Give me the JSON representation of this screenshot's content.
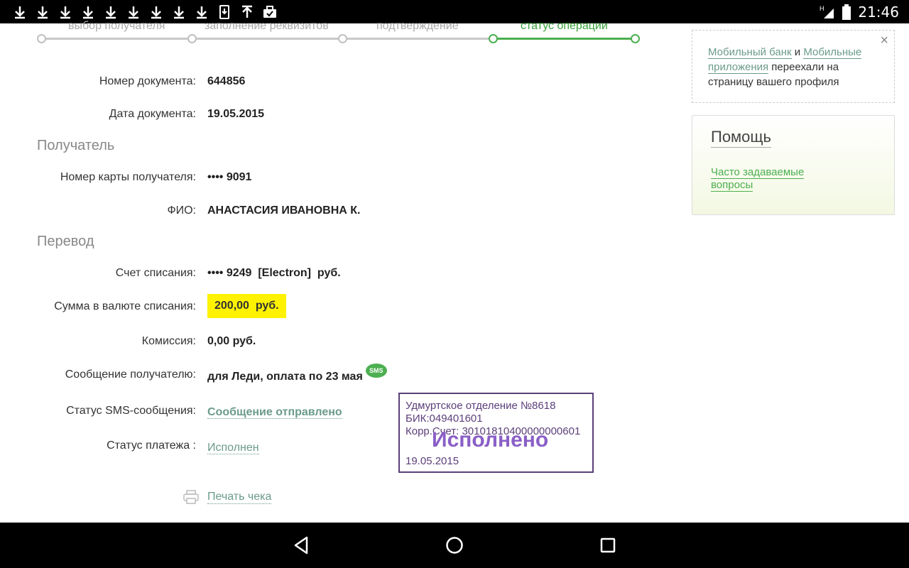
{
  "status_bar": {
    "time": "21:46",
    "network": "H"
  },
  "stepper": {
    "steps": [
      {
        "label": "выбор получателя"
      },
      {
        "label": "заполнение реквизитов"
      },
      {
        "label": "подтверждение"
      },
      {
        "label": "статус операции"
      }
    ]
  },
  "document": {
    "number_label": "Номер документа:",
    "number_value": "644856",
    "date_label": "Дата документа:",
    "date_value": "19.05.2015"
  },
  "recipient": {
    "section_title": "Получатель",
    "card_label": "Номер карты получателя:",
    "card_value": "•••• 9091",
    "name_label": "ФИО:",
    "name_value": "АНАСТАСИЯ ИВАНОВНА К."
  },
  "transfer": {
    "section_title": "Перевод",
    "account_label": "Счет списания:",
    "account_value": "•••• 9249  [Electron]  руб.",
    "amount_label": "Сумма в валюте списания:",
    "amount_value": "200,00  руб.",
    "fee_label": "Комиссия:",
    "fee_value": "0,00 руб.",
    "message_label": "Сообщение получателю:",
    "message_value": "для Леди, оплата по 23 мая",
    "sms_badge": "SMS",
    "sms_status_label": "Статус SMS-сообщения:",
    "sms_status_value": "Сообщение отправлено",
    "payment_status_label": "Статус платежа :",
    "payment_status_value": "Исполнен"
  },
  "stamp": {
    "line1": "Удмуртское отделение №8618",
    "line2": "БИК:049401601",
    "line3": "Корр.Счет: 30101810400000000601",
    "big": "Исполнено",
    "date": "19.05.2015"
  },
  "print": {
    "label": "Печать чека"
  },
  "notice": {
    "link1": "Мобильный банк",
    "and": " и ",
    "link2": "Мобильные приложения",
    "rest": " переехали на страницу вашего профиля",
    "close": "×"
  },
  "help": {
    "title": "Помощь",
    "faq": "Часто задаваемые вопросы"
  }
}
